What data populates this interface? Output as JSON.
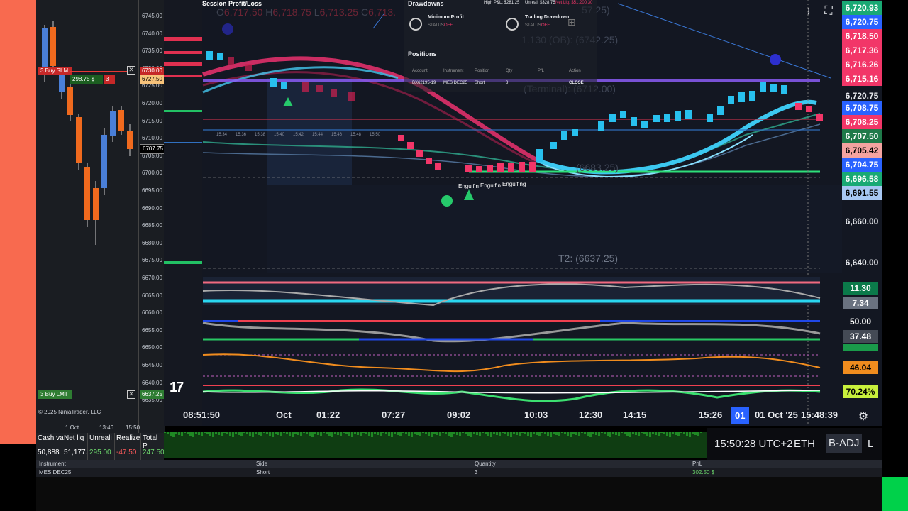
{
  "ninja": {
    "price_ticks": [
      "6745.00",
      "6740.00",
      "6735.00",
      "6730.00",
      "6725.00",
      "6720.00",
      "6715.00",
      "6710.00",
      "6705.00",
      "6700.00",
      "6695.00",
      "6690.00",
      "6685.00",
      "6680.00",
      "6675.00",
      "6670.00",
      "6665.00",
      "6660.00",
      "6655.00",
      "6650.00",
      "6645.00",
      "6640.00",
      "6635.00"
    ],
    "order_sell_label": "3 Buy SLM",
    "order_sell_qty": "3",
    "order_sell_price": "6730.00",
    "order_pl": "298.75 $",
    "current_price": "6727.50",
    "last_price": "6707.75",
    "order_buy_label": "3 Buy LMT",
    "order_buy_price": "6637.25",
    "copyright": "© 2025 NinjaTrader, LLC",
    "dates": [
      "1 Oct",
      "13:46",
      "15:50"
    ]
  },
  "account": {
    "headers": [
      "Cash va",
      "Net liq",
      "Unreali",
      "Realize",
      "Total P"
    ],
    "values": [
      "50,888",
      "51,177.",
      "295.00",
      "-47.50",
      "247.50"
    ],
    "value_colors": [
      "#ffffff",
      "#ffffff",
      "#6cd66c",
      "#ff5a5a",
      "#6cd66c"
    ]
  },
  "positions_table": {
    "headers": [
      "Instrument",
      "Side",
      "Quantity",
      "PnL"
    ],
    "row": [
      "MES DEC25",
      "Short",
      "3",
      "302.50 $"
    ]
  },
  "panel": {
    "session_title": "Session Profit/Loss",
    "drawdowns_title": "Drawdowns",
    "high_pl": "High P&L: $281.25",
    "unreal": "Unreal: $328.75",
    "net_liq": "Net Liq: $51,200.30",
    "min_profit": "Minimum Profit",
    "min_status_label": "STATUS:",
    "min_status": "OFF",
    "trailing": "Trailing Drawdown",
    "trailing_status_label": "STATUS:",
    "trailing_status": "OFF",
    "positions_title": "Positions",
    "pos_headers": [
      "Account",
      "Instrument",
      "Position",
      "Qty",
      "P/L",
      "Action"
    ],
    "pos_row": [
      "BX62195-19",
      "MES DEC25",
      "Short",
      "3",
      "",
      "CLOSE"
    ],
    "mini_times": [
      "15:34",
      "15:36",
      "15:38",
      "15:40",
      "15:42",
      "15:44",
      "15:46",
      "15:48",
      "15:50"
    ]
  },
  "ohlc": {
    "o_label": "O",
    "o": "6,717.50",
    "h_label": "H",
    "h": "6,718.75",
    "l_label": "L",
    "l": "6,713.25",
    "c_label": "C",
    "c": "6,713."
  },
  "chart_text": {
    "target1": "1.130 (OB): (6742.25)",
    "target_top": "57.25)",
    "terminal": "(Terminal): (6712.00)",
    "mid": "(6683.25)",
    "t2": "T2: (6637.25)",
    "engulf1": "Engulfin",
    "engulf2": "Engulfin",
    "engulf3": "Engulfing"
  },
  "price_axis": [
    {
      "label": "6,720.93",
      "color": "#19a974"
    },
    {
      "label": "6,720.75",
      "color": "#2962ff"
    },
    {
      "label": "6,718.50",
      "color": "#f23668"
    },
    {
      "label": "6,717.36",
      "color": "#f23668"
    },
    {
      "label": "6,716.26",
      "color": "#f23668"
    },
    {
      "label": "6,715.16",
      "color": "#f23668"
    },
    {
      "label": "6,720.75",
      "color": ""
    },
    {
      "label": "6,708.75",
      "color": "#2962ff"
    },
    {
      "label": "6,708.25",
      "color": "#f23668"
    },
    {
      "label": "6,707.50",
      "color": "#1f7a4a"
    },
    {
      "label": "6,705.42",
      "color": "#f4a3a0"
    },
    {
      "label": "6,704.75",
      "color": "#2962ff"
    },
    {
      "label": "6,696.58",
      "color": "#19a974"
    },
    {
      "label": "6,691.55",
      "color": "#a7c7f2"
    },
    {
      "label": "6,660.00",
      "color": ""
    },
    {
      "label": "6,640.00",
      "color": ""
    }
  ],
  "indicators": {
    "i1": "11.30",
    "i2": "7.34",
    "i3": "50.00",
    "i4": "37.48",
    "i5": "46.04",
    "i6": "70.24%"
  },
  "time_axis": [
    {
      "label": "08:51:50"
    },
    {
      "label": "Oct"
    },
    {
      "label": "01:22"
    },
    {
      "label": "07:27"
    },
    {
      "label": "09:02"
    },
    {
      "label": "10:03"
    },
    {
      "label": "12:30"
    },
    {
      "label": "14:15"
    },
    {
      "label": "15:26"
    },
    {
      "label": "01 Oct '25"
    },
    {
      "label": "15:48:39"
    }
  ],
  "time_axis_cursor": "01 C",
  "status": {
    "clock": "15:50:28 UTC+2",
    "session": "ETH",
    "adj": "B-ADJ",
    "extra": "L"
  },
  "tv_logo": "17",
  "icons": [
    "download-icon",
    "fullscreen-icon",
    "settings-gear-icon",
    "add-icon"
  ]
}
